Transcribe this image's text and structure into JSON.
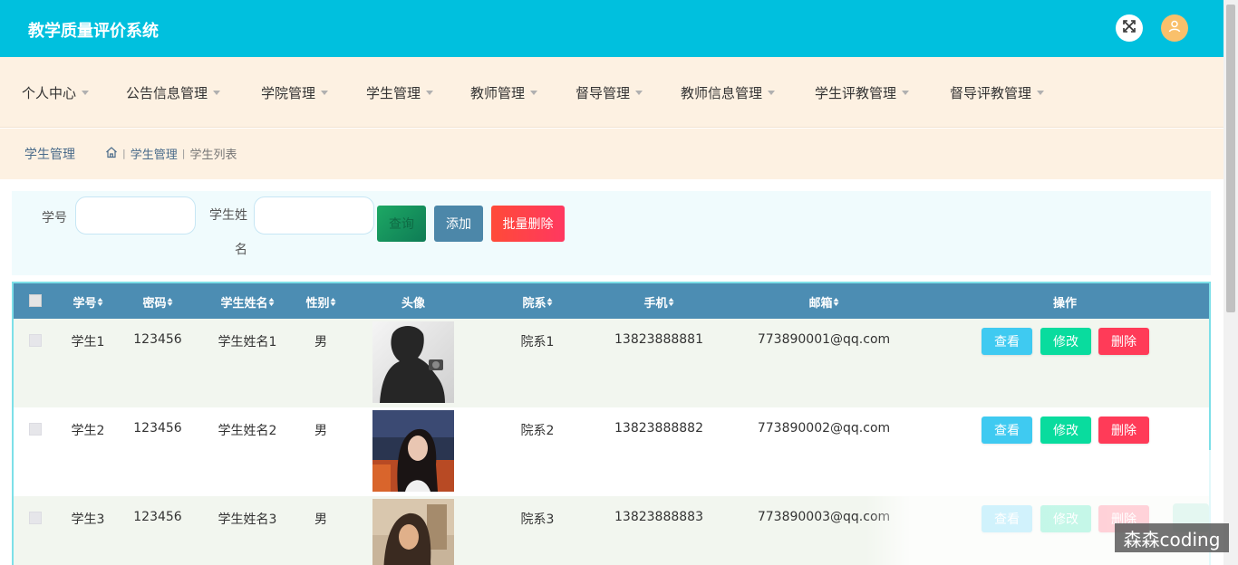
{
  "header": {
    "title": "教学质量评价系统",
    "expand_icon": "fullscreen-icon",
    "user_icon": "user-icon",
    "accent": "#00c0de"
  },
  "nav": {
    "items": [
      {
        "label": "个人中心"
      },
      {
        "label": "公告信息管理"
      },
      {
        "label": "学院管理"
      },
      {
        "label": "学生管理"
      },
      {
        "label": "教师管理"
      },
      {
        "label": "督导管理"
      },
      {
        "label": "教师信息管理"
      },
      {
        "label": "学生评教管理"
      },
      {
        "label": "督导评教管理"
      }
    ]
  },
  "breadcrumb": {
    "title": "学生管理",
    "home_icon": "home-icon",
    "items": [
      "学生管理",
      "学生列表"
    ]
  },
  "search": {
    "fields": [
      {
        "label": "学号",
        "value": "",
        "placeholder": ""
      },
      {
        "label": "学生姓名",
        "value": "",
        "placeholder": ""
      }
    ],
    "buttons": {
      "query": "查询",
      "add": "添加",
      "batch_delete": "批量删除"
    }
  },
  "table": {
    "columns": [
      "学号",
      "密码",
      "学生姓名",
      "性别",
      "头像",
      "院系",
      "手机",
      "邮箱",
      "操作"
    ],
    "rows": [
      {
        "id": "学生1",
        "password": "123456",
        "name": "学生姓名1",
        "gender": "男",
        "dept": "院系1",
        "phone": "13823888881",
        "email": "773890001@qq.com"
      },
      {
        "id": "学生2",
        "password": "123456",
        "name": "学生姓名2",
        "gender": "男",
        "dept": "院系2",
        "phone": "13823888882",
        "email": "773890002@qq.com"
      },
      {
        "id": "学生3",
        "password": "123456",
        "name": "学生姓名3",
        "gender": "男",
        "dept": "院系3",
        "phone": "13823888883",
        "email": "773890003@qq.com"
      }
    ],
    "actions": {
      "view": "查看",
      "edit": "修改",
      "delete": "删除"
    }
  },
  "watermark": "森森coding"
}
